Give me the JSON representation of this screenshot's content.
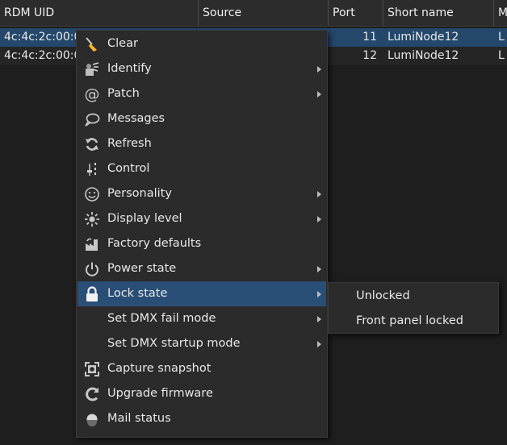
{
  "table": {
    "columns": [
      {
        "label": "RDM UID"
      },
      {
        "label": "Source"
      },
      {
        "label": "Port"
      },
      {
        "label": "Short name"
      },
      {
        "label": "M"
      }
    ],
    "rows": [
      {
        "uid": "4c:4c:2c:00:0",
        "source": "",
        "port": "11",
        "short_name": "LumiNode12",
        "m": "L"
      },
      {
        "uid": "4c:4c:2c:00:0",
        "source": "",
        "port": "12",
        "short_name": "LumiNode12",
        "m": "L"
      }
    ]
  },
  "context_menu": {
    "items": [
      {
        "label": "Clear",
        "icon": "broom-icon"
      },
      {
        "label": "Identify",
        "icon": "identify-icon"
      },
      {
        "label": "Patch",
        "icon": "at-sign-icon"
      },
      {
        "label": "Messages",
        "icon": "speech-bubble-icon"
      },
      {
        "label": "Refresh",
        "icon": "refresh-icon"
      },
      {
        "label": "Control",
        "icon": "control-icon"
      },
      {
        "label": "Personality",
        "icon": "smiley-icon"
      },
      {
        "label": "Display level",
        "icon": "brightness-icon"
      },
      {
        "label": "Factory defaults",
        "icon": "factory-icon"
      },
      {
        "label": "Power state",
        "icon": "power-icon"
      },
      {
        "label": "Lock state",
        "icon": "lock-icon"
      },
      {
        "label": "Set DMX fail mode",
        "icon": ""
      },
      {
        "label": "Set DMX startup mode",
        "icon": ""
      },
      {
        "label": "Capture snapshot",
        "icon": "capture-icon"
      },
      {
        "label": "Upgrade firmware",
        "icon": "upgrade-icon"
      },
      {
        "label": "Mail status",
        "icon": "mail-status-icon"
      }
    ]
  },
  "lock_submenu": {
    "items": [
      {
        "label": "Unlocked"
      },
      {
        "label": "Front panel locked"
      }
    ]
  },
  "colors": {
    "background": "#1e1e1e",
    "header": "#2c2c2c",
    "selection": "#24486c",
    "menu_background": "#2b2b2b",
    "menu_highlight": "#2a4f76",
    "text": "#e6e6e6",
    "clear_icon": "#f5b72a"
  }
}
